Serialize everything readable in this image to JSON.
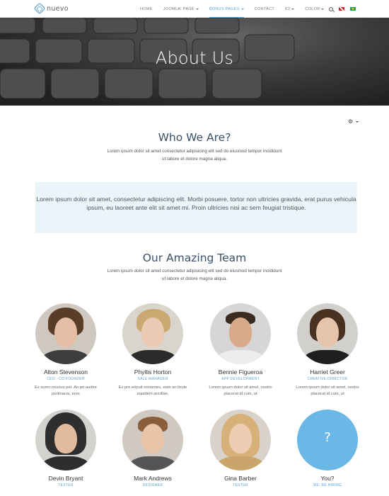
{
  "brand": {
    "name": "nuevo"
  },
  "nav": {
    "items": [
      {
        "label": "HOME",
        "dropdown": false,
        "active": false
      },
      {
        "label": "JOOMLA! PAGE",
        "dropdown": true,
        "active": false
      },
      {
        "label": "BONUS PAGES",
        "dropdown": true,
        "active": true
      },
      {
        "label": "CONTACT",
        "dropdown": false,
        "active": false
      },
      {
        "label": "K2",
        "dropdown": true,
        "active": false
      },
      {
        "label": "COLOR",
        "dropdown": true,
        "active": false
      }
    ],
    "tools": {
      "search_icon": "search-icon",
      "flags": [
        "flag-uk",
        "flag-br"
      ]
    }
  },
  "hero": {
    "title": "About Us"
  },
  "who": {
    "title": "Who We Are?",
    "text": "Lorem ipsum dolor sit amet consectetur adipisicing elit sed do eiusmod tempor incididunt ut labore et dolore magna aliqua."
  },
  "quote": {
    "text": "Lorem ipsum dolor sit amet, consectetur adipiscing elit. Morbi posuere, tortor non ultricies gravida, erat purus vehicula ipsum, eu laoreet ante elit sit amet mi. Proin ultricies nisi ac sem feugiat tristique."
  },
  "team": {
    "title": "Our Amazing Team",
    "text": "Lorem ipsum dolor sit amet consectetur adipisicing elit sed do eiusmod tempor incididunt ut labore et dolore magna aliqua.",
    "members": [
      {
        "name": "Alton Stevenson",
        "role": "CEO - CO FOUNDER",
        "desc": "Ex sumo mucius per. An pri audire pertinacia, eros"
      },
      {
        "name": "Phyllis Horton",
        "role": "SALE MANAGER",
        "desc": "Ex pro eripuit nonumes, eam an brute equidem ancillae,"
      },
      {
        "name": "Bennie Figueroa",
        "role": "APP DEVELOPMENT",
        "desc": "Lorem ipsum dolor sit amet, nostro placerat id cum, ut"
      },
      {
        "name": "Harriet Greer",
        "role": "CREATIVE DIRECTOR",
        "desc": "Lorem ipsum dolor sit amet, nostro placerat id cum, ut"
      },
      {
        "name": "Devin Bryant",
        "role": "TESTER",
        "desc": ""
      },
      {
        "name": "Mark Andrews",
        "role": "DESIGNER",
        "desc": ""
      },
      {
        "name": "Gina Barber",
        "role": "TESTER",
        "desc": ""
      },
      {
        "name": "You?",
        "role": "WE' RE HIRING",
        "desc": "",
        "placeholder": "?"
      }
    ]
  },
  "colors": {
    "accent": "#5aa3d6",
    "quote_bg": "#eaf4fb",
    "heading": "#3a5068",
    "hiring_circle": "#6bb8e6"
  }
}
